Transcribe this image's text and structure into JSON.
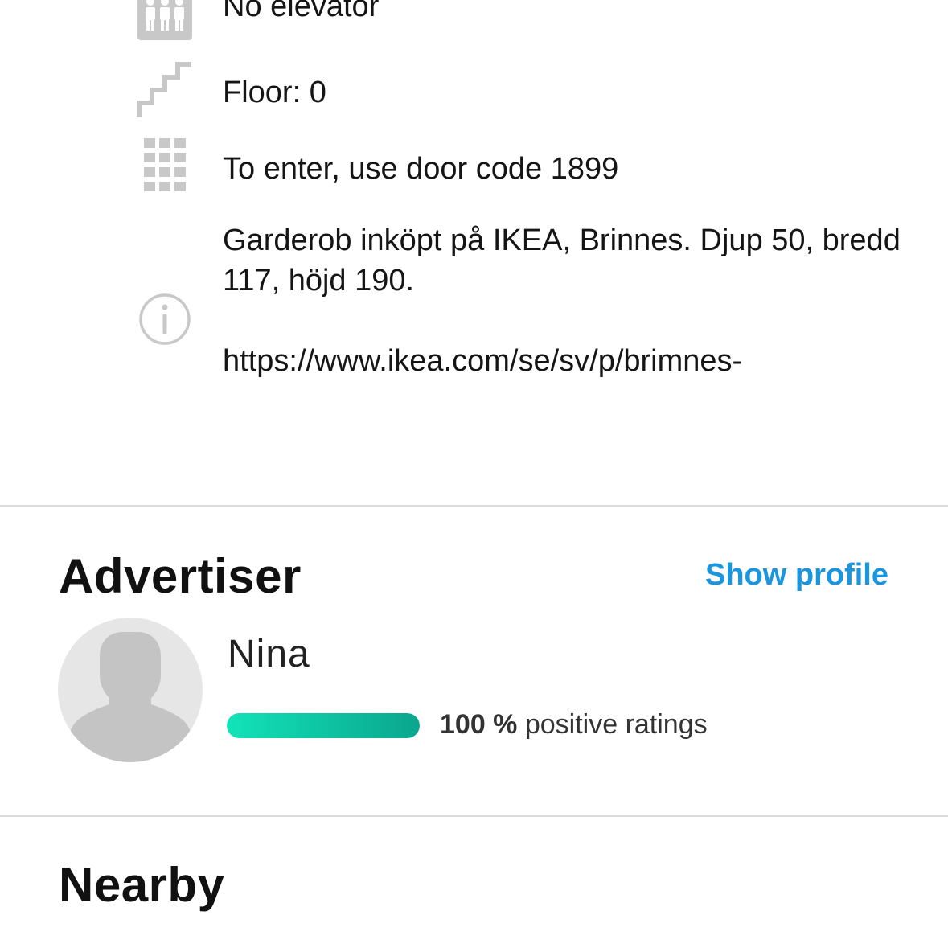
{
  "details": {
    "elevator": {
      "icon": "elevator-icon",
      "text": "No elevator"
    },
    "floor": {
      "icon": "stairs-icon",
      "text": "Floor: 0"
    },
    "door": {
      "icon": "keypad-icon",
      "text": "To enter, use door code 1899"
    },
    "info": {
      "icon": "info-icon",
      "text": "Garderob inköpt på IKEA, Brinnes. Djup 50, bredd 117, höjd 190.",
      "link": "https://www.ikea.com/se/sv/p/brimnes-"
    }
  },
  "advertiser": {
    "title": "Advertiser",
    "show_profile_label": "Show profile",
    "name": "Nina",
    "rating_percent_label": "100 %",
    "rating_suffix": " positive ratings",
    "rating_fraction": 1.0
  },
  "nearby": {
    "title": "Nearby"
  },
  "colors": {
    "accent": "#1a96e0",
    "rating_start": "#12e3b8",
    "rating_end": "#0aa68d",
    "icon_gray": "#c8c8c8",
    "divider": "#dcdcdc"
  }
}
